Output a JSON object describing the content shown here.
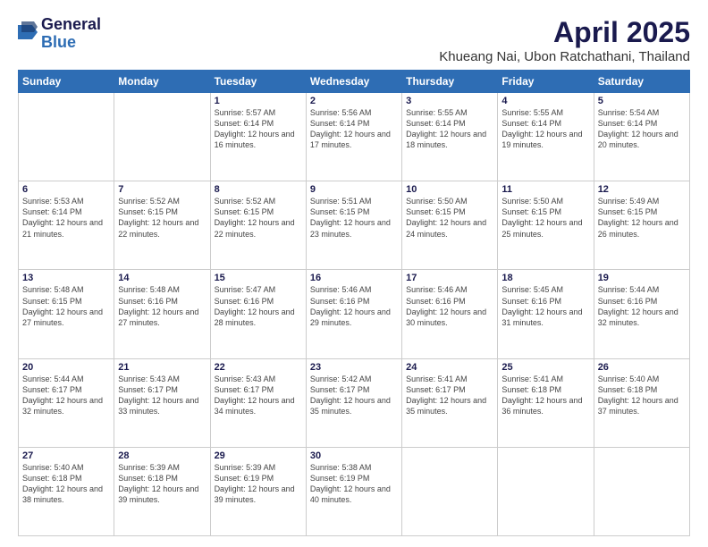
{
  "header": {
    "logo_general": "General",
    "logo_blue": "Blue",
    "month_title": "April 2025",
    "location": "Khueang Nai, Ubon Ratchathani, Thailand"
  },
  "days_of_week": [
    "Sunday",
    "Monday",
    "Tuesday",
    "Wednesday",
    "Thursday",
    "Friday",
    "Saturday"
  ],
  "weeks": [
    [
      {
        "day": "",
        "info": ""
      },
      {
        "day": "",
        "info": ""
      },
      {
        "day": "1",
        "info": "Sunrise: 5:57 AM\nSunset: 6:14 PM\nDaylight: 12 hours and 16 minutes."
      },
      {
        "day": "2",
        "info": "Sunrise: 5:56 AM\nSunset: 6:14 PM\nDaylight: 12 hours and 17 minutes."
      },
      {
        "day": "3",
        "info": "Sunrise: 5:55 AM\nSunset: 6:14 PM\nDaylight: 12 hours and 18 minutes."
      },
      {
        "day": "4",
        "info": "Sunrise: 5:55 AM\nSunset: 6:14 PM\nDaylight: 12 hours and 19 minutes."
      },
      {
        "day": "5",
        "info": "Sunrise: 5:54 AM\nSunset: 6:14 PM\nDaylight: 12 hours and 20 minutes."
      }
    ],
    [
      {
        "day": "6",
        "info": "Sunrise: 5:53 AM\nSunset: 6:14 PM\nDaylight: 12 hours and 21 minutes."
      },
      {
        "day": "7",
        "info": "Sunrise: 5:52 AM\nSunset: 6:15 PM\nDaylight: 12 hours and 22 minutes."
      },
      {
        "day": "8",
        "info": "Sunrise: 5:52 AM\nSunset: 6:15 PM\nDaylight: 12 hours and 22 minutes."
      },
      {
        "day": "9",
        "info": "Sunrise: 5:51 AM\nSunset: 6:15 PM\nDaylight: 12 hours and 23 minutes."
      },
      {
        "day": "10",
        "info": "Sunrise: 5:50 AM\nSunset: 6:15 PM\nDaylight: 12 hours and 24 minutes."
      },
      {
        "day": "11",
        "info": "Sunrise: 5:50 AM\nSunset: 6:15 PM\nDaylight: 12 hours and 25 minutes."
      },
      {
        "day": "12",
        "info": "Sunrise: 5:49 AM\nSunset: 6:15 PM\nDaylight: 12 hours and 26 minutes."
      }
    ],
    [
      {
        "day": "13",
        "info": "Sunrise: 5:48 AM\nSunset: 6:15 PM\nDaylight: 12 hours and 27 minutes."
      },
      {
        "day": "14",
        "info": "Sunrise: 5:48 AM\nSunset: 6:16 PM\nDaylight: 12 hours and 27 minutes."
      },
      {
        "day": "15",
        "info": "Sunrise: 5:47 AM\nSunset: 6:16 PM\nDaylight: 12 hours and 28 minutes."
      },
      {
        "day": "16",
        "info": "Sunrise: 5:46 AM\nSunset: 6:16 PM\nDaylight: 12 hours and 29 minutes."
      },
      {
        "day": "17",
        "info": "Sunrise: 5:46 AM\nSunset: 6:16 PM\nDaylight: 12 hours and 30 minutes."
      },
      {
        "day": "18",
        "info": "Sunrise: 5:45 AM\nSunset: 6:16 PM\nDaylight: 12 hours and 31 minutes."
      },
      {
        "day": "19",
        "info": "Sunrise: 5:44 AM\nSunset: 6:16 PM\nDaylight: 12 hours and 32 minutes."
      }
    ],
    [
      {
        "day": "20",
        "info": "Sunrise: 5:44 AM\nSunset: 6:17 PM\nDaylight: 12 hours and 32 minutes."
      },
      {
        "day": "21",
        "info": "Sunrise: 5:43 AM\nSunset: 6:17 PM\nDaylight: 12 hours and 33 minutes."
      },
      {
        "day": "22",
        "info": "Sunrise: 5:43 AM\nSunset: 6:17 PM\nDaylight: 12 hours and 34 minutes."
      },
      {
        "day": "23",
        "info": "Sunrise: 5:42 AM\nSunset: 6:17 PM\nDaylight: 12 hours and 35 minutes."
      },
      {
        "day": "24",
        "info": "Sunrise: 5:41 AM\nSunset: 6:17 PM\nDaylight: 12 hours and 35 minutes."
      },
      {
        "day": "25",
        "info": "Sunrise: 5:41 AM\nSunset: 6:18 PM\nDaylight: 12 hours and 36 minutes."
      },
      {
        "day": "26",
        "info": "Sunrise: 5:40 AM\nSunset: 6:18 PM\nDaylight: 12 hours and 37 minutes."
      }
    ],
    [
      {
        "day": "27",
        "info": "Sunrise: 5:40 AM\nSunset: 6:18 PM\nDaylight: 12 hours and 38 minutes."
      },
      {
        "day": "28",
        "info": "Sunrise: 5:39 AM\nSunset: 6:18 PM\nDaylight: 12 hours and 39 minutes."
      },
      {
        "day": "29",
        "info": "Sunrise: 5:39 AM\nSunset: 6:19 PM\nDaylight: 12 hours and 39 minutes."
      },
      {
        "day": "30",
        "info": "Sunrise: 5:38 AM\nSunset: 6:19 PM\nDaylight: 12 hours and 40 minutes."
      },
      {
        "day": "",
        "info": ""
      },
      {
        "day": "",
        "info": ""
      },
      {
        "day": "",
        "info": ""
      }
    ]
  ]
}
